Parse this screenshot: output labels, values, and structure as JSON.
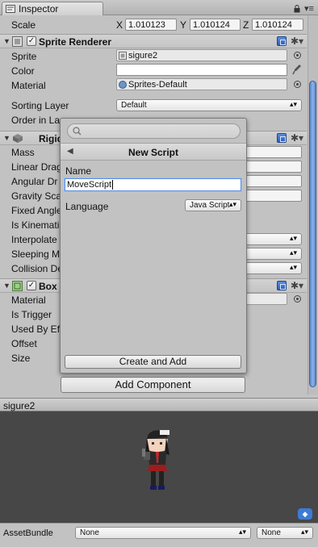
{
  "tab": {
    "title": "Inspector"
  },
  "scale": {
    "label": "Scale",
    "x_label": "X",
    "x": "1.010123",
    "y_label": "Y",
    "y": "1.010124",
    "z_label": "Z",
    "z": "1.010124"
  },
  "sprite_renderer": {
    "title": "Sprite Renderer",
    "sprite_label": "Sprite",
    "sprite_value": "sigure2",
    "color_label": "Color",
    "material_label": "Material",
    "material_value": "Sprites-Default",
    "sorting_layer_label": "Sorting Layer",
    "sorting_layer_value": "Default",
    "order_label": "Order in La"
  },
  "rigidbody": {
    "title": "Rigid",
    "fields": [
      "Mass",
      "Linear Drag",
      "Angular Dr",
      "Gravity Sca",
      "Fixed Angle",
      "Is Kinemati",
      "Interpolate",
      "Sleeping Mo",
      "Collision De"
    ]
  },
  "box_collider": {
    "title": "Box",
    "fields": [
      "Material",
      "Is Trigger",
      "Used By Eff",
      "Offset",
      "Size"
    ]
  },
  "popup": {
    "search_placeholder": "",
    "header_title": "New Script",
    "back_glyph": "◀",
    "name_label": "Name",
    "name_value": "MoveScript",
    "language_label": "Language",
    "language_value": "Java Script",
    "create_button": "Create and Add"
  },
  "add_component": "Add Component",
  "preview": {
    "title": "sigure2"
  },
  "asset_bundle": {
    "label": "AssetBundle",
    "bundle_value": "None",
    "variant_value": "None"
  },
  "icons": {
    "lock": "lock-icon",
    "menu": "menu-icon",
    "gear": "gear-icon",
    "help": "help-book-icon",
    "eyedropper": "eyedropper-icon"
  },
  "colors": {
    "selection_blue": "#5a8ede",
    "panel": "#c2c2c2",
    "preview_bg": "#474747"
  }
}
